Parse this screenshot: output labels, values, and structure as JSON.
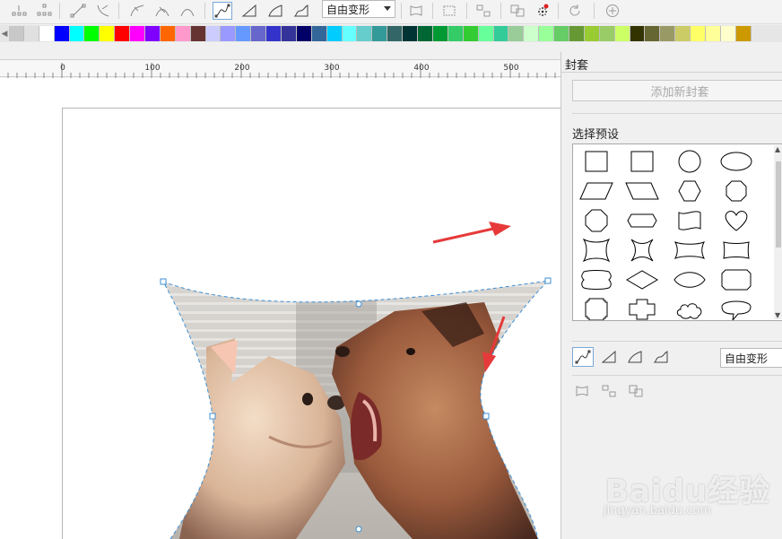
{
  "toolbar": {
    "mode_select_value": "自由变形",
    "icons": [
      "node-group-icon",
      "node-group-2-icon",
      "line-node-icon",
      "curve-node-icon",
      "arc-node-icon",
      "arc-node-2-icon",
      "arc-node-3-icon",
      "freeform-mode-icon",
      "straight-line-mode-icon",
      "single-arc-mode-icon",
      "double-arc-mode-icon",
      "envelope-reset-icon",
      "envelope-copy-icon",
      "create-envelope-icon",
      "convert-icon",
      "clear-envelope-icon",
      "refresh-icon",
      "add-icon"
    ]
  },
  "palette": {
    "colors": [
      "#c8c8c8",
      "#e0e0e0",
      "#ffffff",
      "#0000ff",
      "#00ffff",
      "#00ff00",
      "#ffff00",
      "#ff0000",
      "#ff00ff",
      "#7f00ff",
      "#ff6600",
      "#ff99cc",
      "#663333",
      "#ccccff",
      "#9999ff",
      "#6699ff",
      "#6666cc",
      "#3333cc",
      "#333399",
      "#000066",
      "#336699",
      "#00ccff",
      "#66ffff",
      "#66cccc",
      "#339999",
      "#336666",
      "#003333",
      "#006633",
      "#009933",
      "#33cc66",
      "#33cc33",
      "#66ff99",
      "#33cc99",
      "#99cc99",
      "#ccffcc",
      "#99ff99",
      "#66cc66",
      "#669933",
      "#99cc33",
      "#99cc66",
      "#ccff66",
      "#333300",
      "#666633",
      "#999966",
      "#cccc66",
      "#ffff66",
      "#ffff99",
      "#ffffcc",
      "#cc9900"
    ]
  },
  "ruler": {
    "labels": [
      "0",
      "100",
      "200",
      "300",
      "400",
      "500"
    ]
  },
  "docker": {
    "title": "封套",
    "add_button": "添加新封套",
    "preset_label": "选择预设",
    "mode_select_value": "自由变形",
    "presets": [
      "rectangle",
      "square",
      "circle",
      "ellipse",
      "parallelogram",
      "trapezoid",
      "hexagon",
      "octagon",
      "octagon-2",
      "rounded-tag",
      "flag",
      "heart",
      "concave-square",
      "star-4",
      "banner",
      "wave-rect",
      "scroll",
      "diamond",
      "lens",
      "notched-rect",
      "rounded-rect",
      "cross",
      "cloud",
      "speech-bubble"
    ]
  },
  "watermark": {
    "brand": "Baidu经验",
    "url": "jingyan.baidu.com"
  }
}
